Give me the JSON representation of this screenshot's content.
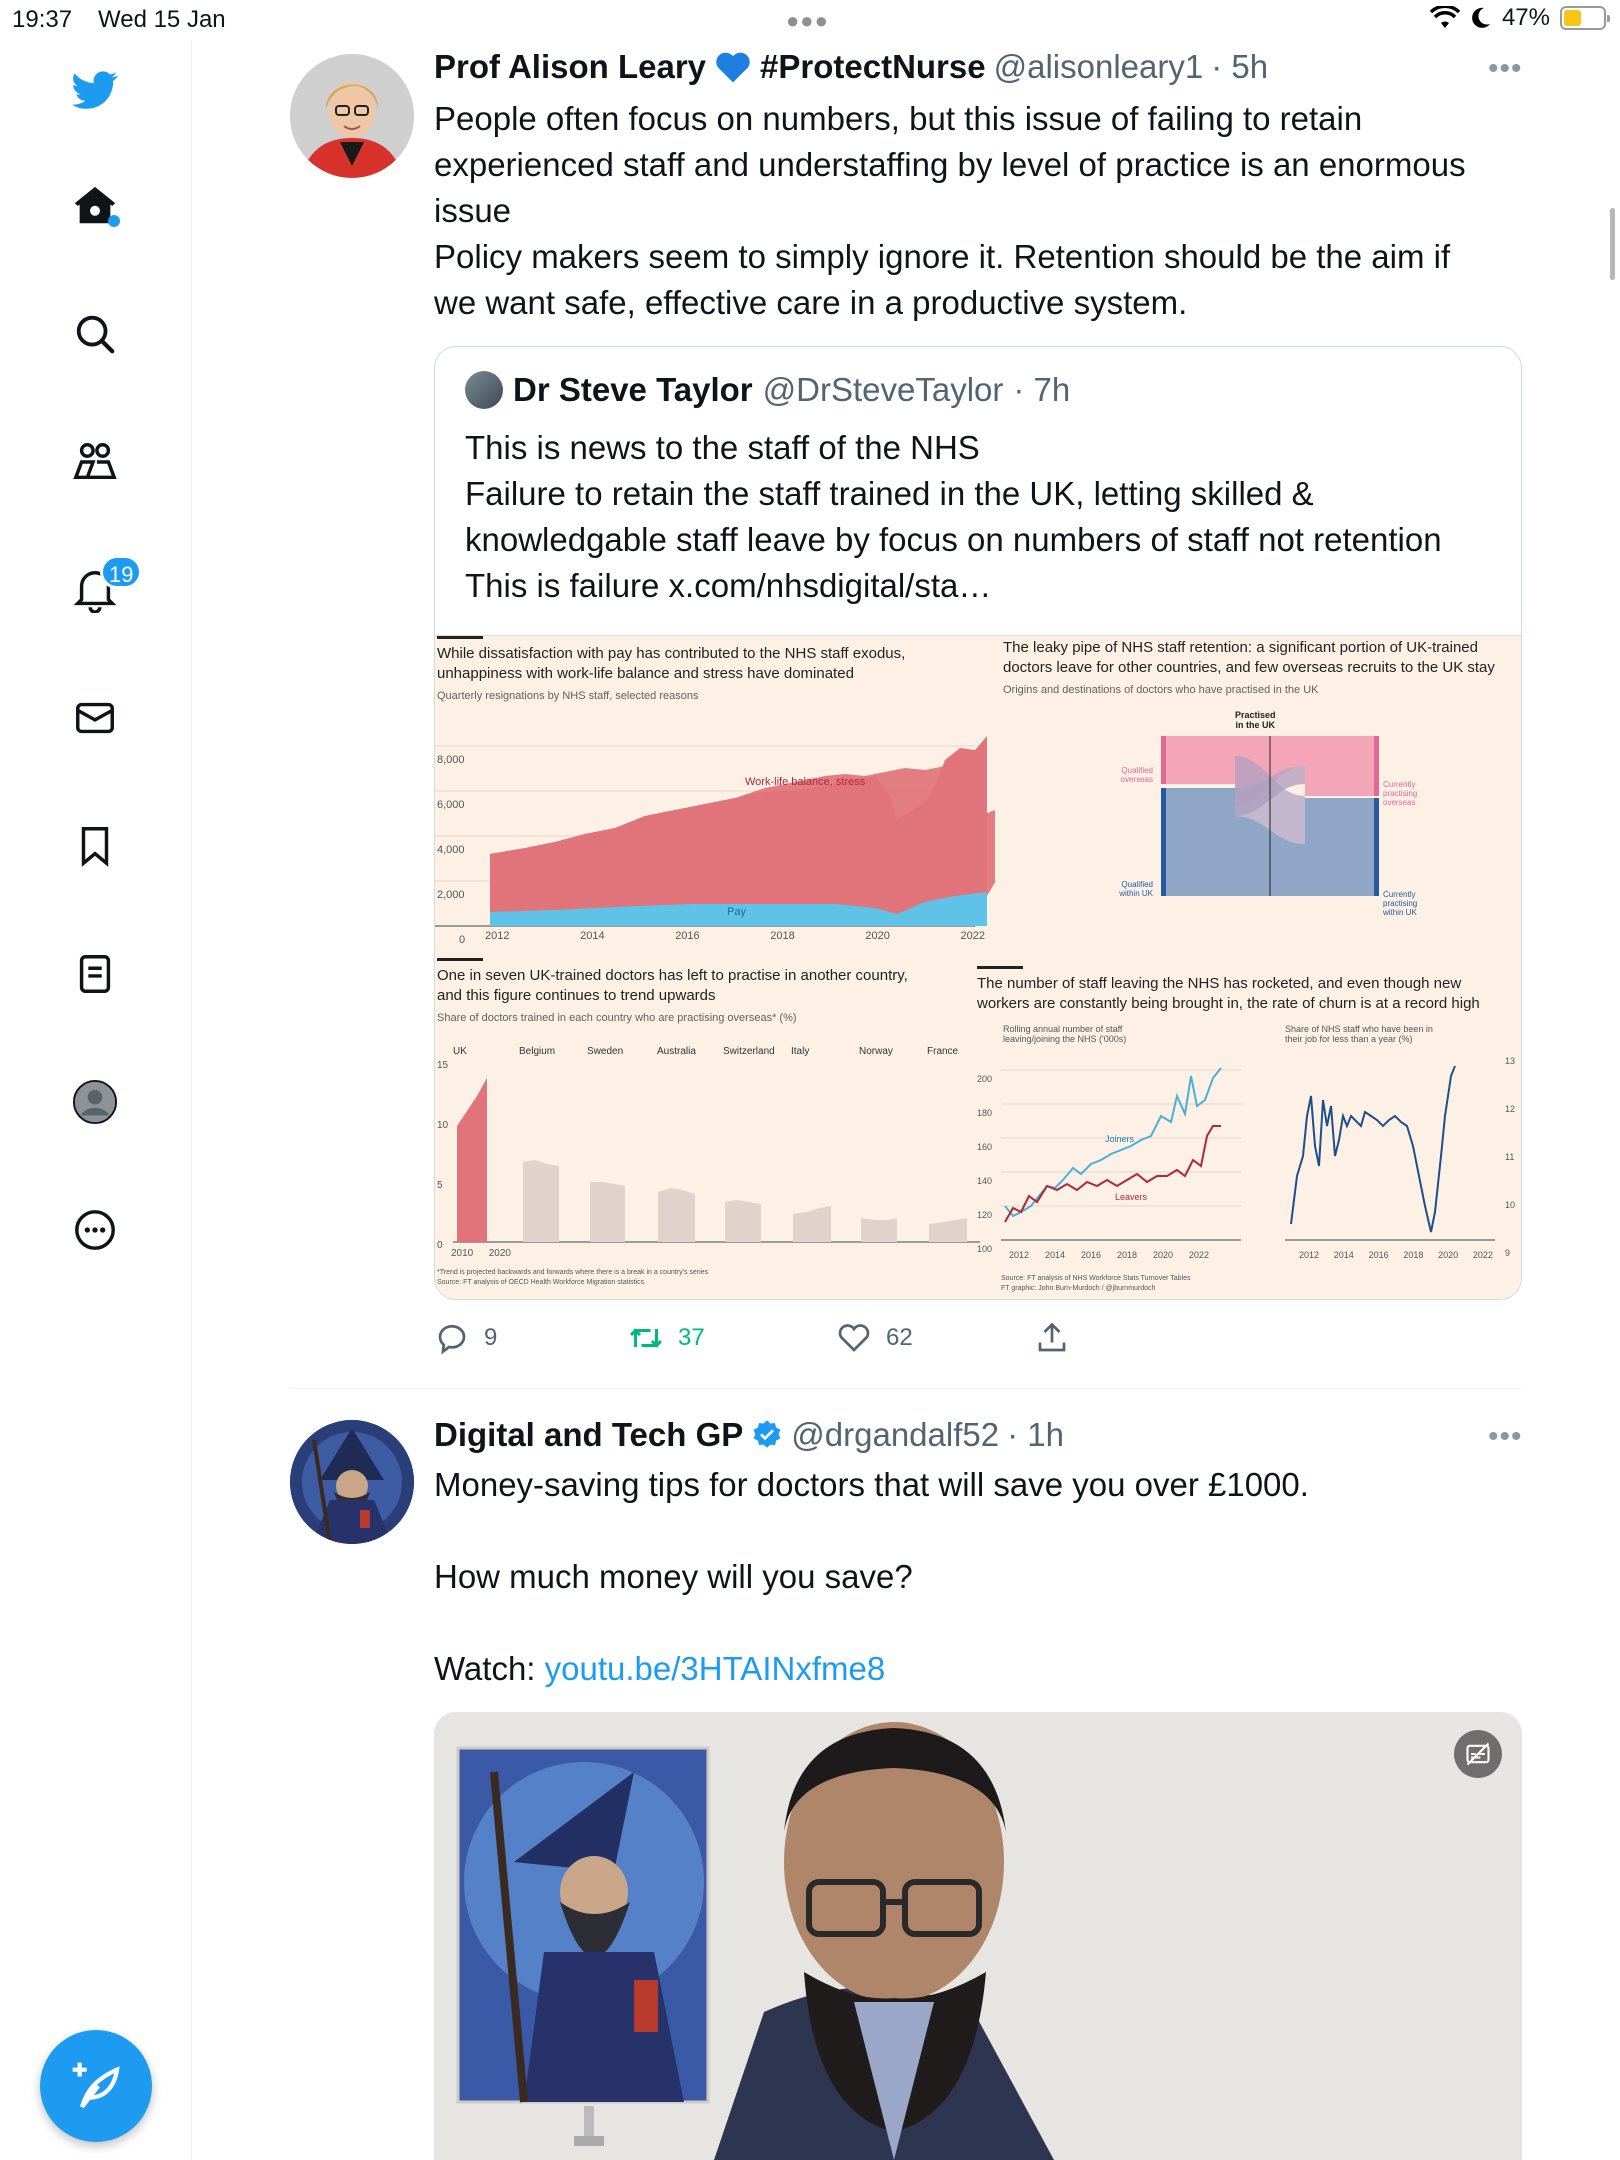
{
  "status_bar": {
    "time": "19:37",
    "date": "Wed 15 Jan",
    "battery": "47%"
  },
  "sidebar": {
    "notifications_badge": "19",
    "items": [
      "twitter-logo",
      "home",
      "search",
      "communities",
      "notifications",
      "messages",
      "bookmarks",
      "lists",
      "profile",
      "more"
    ]
  },
  "tweet1": {
    "name": "Prof Alison Leary",
    "hashtag": "#ProtectNurse",
    "handle": "@alisonleary1",
    "time": "· 5h",
    "lines": [
      "People often focus on numbers, but this issue of failing to retain",
      "experienced staff and understaffing by level of practice is an enormous",
      "issue",
      "Policy makers seem to simply ignore it. Retention should be the aim if",
      "we want safe, effective care in a productive system."
    ],
    "quote": {
      "name": "Dr Steve Taylor",
      "handle": "@DrSteveTaylor",
      "time": "· 7h",
      "lines": [
        "This is news to the staff of the NHS",
        "Failure to retain the staff trained in the UK, letting skilled &",
        "knowledgable staff leave by focus on numbers of staff not retention",
        "This is failure x.com/nhsdigital/sta…"
      ],
      "image": {
        "panel1": {
          "title1": "While dissatisfaction with pay has contributed to the NHS staff exodus,",
          "title2": "unhappiness with work-life balance and stress have dominated",
          "sub": "Quarterly resignations by NHS staff, selected reasons",
          "series1": "Work-life balance, stress",
          "series2": "Pay",
          "yticks": [
            "8,000",
            "6,000",
            "4,000",
            "2,000",
            "0"
          ],
          "xticks": [
            "2012",
            "2014",
            "2016",
            "2018",
            "2020",
            "2022"
          ]
        },
        "panel2": {
          "title1": "The leaky pipe of NHS staff retention: a significant portion of UK-trained",
          "title2": "doctors leave for other countries, and few overseas recruits to the UK stay",
          "sub": "Origins and destinations of doctors who have practised in the UK",
          "center1": "Practised",
          "center2": "in the UK",
          "left_top1": "Qualified",
          "left_top2": "overseas",
          "left_bot1": "Qualified",
          "left_bot2": "within UK",
          "right_top1": "Currently",
          "right_top2": "practising",
          "right_top3": "overseas",
          "right_bot1": "Currently",
          "right_bot2": "practising",
          "right_bot3": "within UK"
        },
        "panel3": {
          "title1": "One in seven UK-trained doctors has left to practise in another country,",
          "title2": "and this figure continues to trend upwards",
          "sub": "Share of doctors trained in each country who are practising overseas* (%)",
          "countries": [
            "UK",
            "Belgium",
            "Sweden",
            "Australia",
            "Switzerland",
            "Italy",
            "Norway",
            "France"
          ],
          "yticks": [
            "15",
            "10",
            "5",
            "0"
          ],
          "xticks": [
            "2010",
            "2020"
          ],
          "note1": "*Trend is projected backwards and forwards where there is a break in a country's series",
          "note2": "Source: FT analysis of OECD Health Workforce Migration statistics"
        },
        "panel4": {
          "title1": "The number of staff leaving the NHS has rocketed, and even though new",
          "title2": "workers are constantly being brought in, the rate of churn is at a record high",
          "sub_left1": "Rolling annual number of staff",
          "sub_left2": "leaving/joining the NHS ('000s)",
          "sub_right1": "Share of NHS staff who have been in",
          "sub_right2": "their job for less than a year (%)",
          "joiners": "Joiners",
          "leavers": "Leavers",
          "yticks_left": [
            "200",
            "180",
            "160",
            "140",
            "120",
            "100"
          ],
          "yticks_right": [
            "13",
            "12",
            "11",
            "10",
            "9"
          ],
          "xticks": [
            "2012",
            "2014",
            "2016",
            "2018",
            "2020",
            "2022"
          ],
          "source1": "Source: FT analysis of NHS Workforce Stats Turnover Tables",
          "source2": "FT graphic: John Burn-Murdoch / @jburnmurdoch"
        }
      }
    },
    "replies": "9",
    "retweets": "37",
    "likes": "62"
  },
  "tweet2": {
    "name": "Digital and Tech GP",
    "handle": "@drgandalf52",
    "time": "· 1h",
    "line1": "Money-saving tips for doctors that will save you over £1000.",
    "line2": "How much money will you save?",
    "watch": "Watch:",
    "link": "youtu.be/3HTAINxfme8"
  },
  "colors": {
    "accent": "#1d9bf0",
    "retweet_green": "#00ba7c",
    "chart_red": "#e0747a",
    "chart_blue": "#5ec3e6",
    "chart_bg": "#fdf1e6"
  }
}
